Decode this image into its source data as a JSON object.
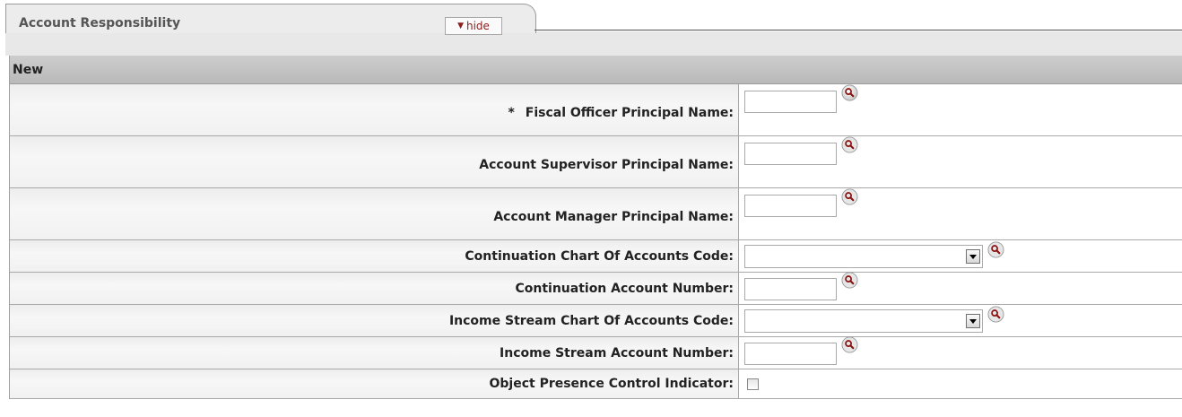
{
  "tab": {
    "title": "Account Responsibility",
    "hide_label": "hide"
  },
  "section": {
    "header": "New"
  },
  "fields": [
    {
      "required_marker": "*",
      "label": "Fiscal Officer Principal Name:",
      "value": ""
    },
    {
      "label": "Account Supervisor Principal Name:",
      "value": ""
    },
    {
      "label": "Account Manager Principal Name:",
      "value": ""
    },
    {
      "label": "Continuation Chart Of Accounts Code:",
      "value": ""
    },
    {
      "label": "Continuation Account Number:",
      "value": ""
    },
    {
      "label": "Income Stream Chart Of Accounts Code:",
      "value": ""
    },
    {
      "label": "Income Stream Account Number:",
      "value": ""
    },
    {
      "label": "Object Presence Control Indicator:",
      "checked": false
    }
  ]
}
